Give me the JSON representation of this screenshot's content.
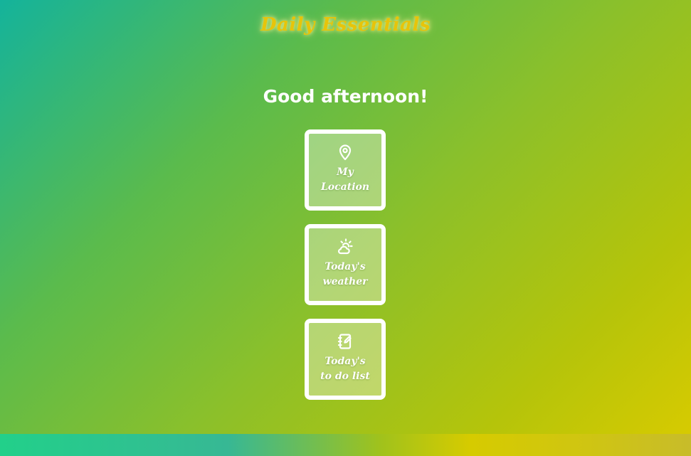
{
  "header": {
    "title": "Daily Essentials"
  },
  "main": {
    "greeting": "Good afternoon!",
    "cards": [
      {
        "icon": "map-pin-icon",
        "label_line1": "My",
        "label_line2": "Location"
      },
      {
        "icon": "weather-sun-cloud-icon",
        "label_line1": "Today's",
        "label_line2": "weather"
      },
      {
        "icon": "notebook-edit-icon",
        "label_line1": "Today's",
        "label_line2": "to do list"
      }
    ]
  },
  "colors": {
    "title": "#e7c40a",
    "card_border": "#ffffff",
    "text": "#ffffff"
  }
}
